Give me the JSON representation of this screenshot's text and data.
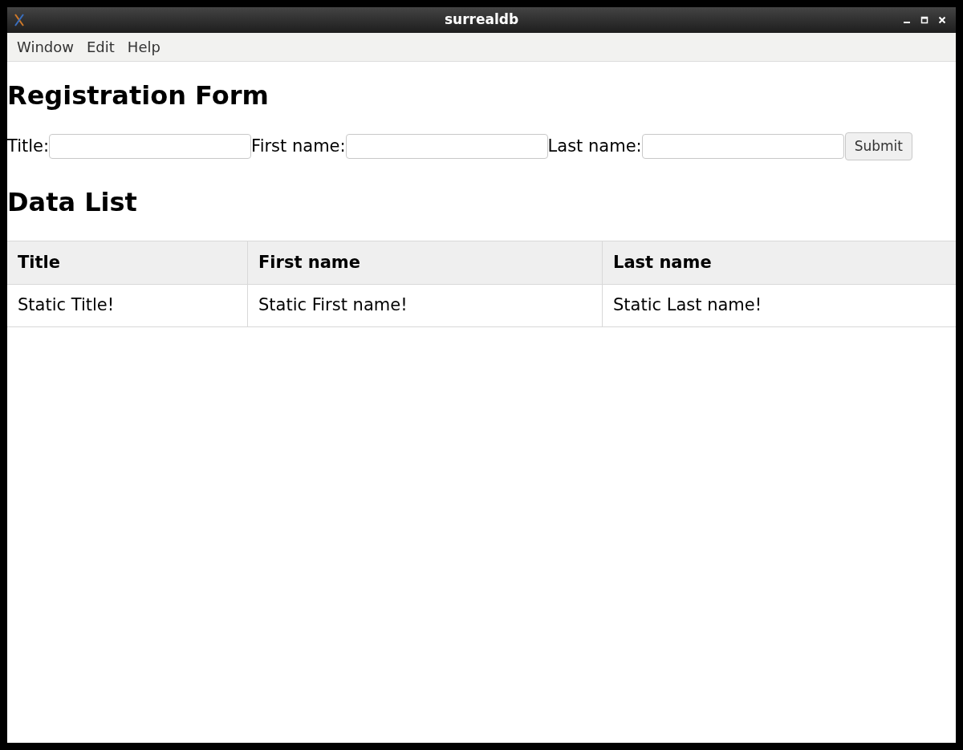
{
  "window": {
    "title": "surrealdb"
  },
  "menu": [
    "Window",
    "Edit",
    "Help"
  ],
  "form": {
    "heading": "Registration Form",
    "fields": [
      {
        "label": "Title:"
      },
      {
        "label": "First name:"
      },
      {
        "label": "Last name:"
      }
    ],
    "submit": "Submit"
  },
  "list": {
    "heading": "Data List",
    "columns": [
      "Title",
      "First name",
      "Last name"
    ],
    "rows": [
      [
        "Static Title!",
        "Static First name!",
        "Static Last name!"
      ]
    ]
  }
}
